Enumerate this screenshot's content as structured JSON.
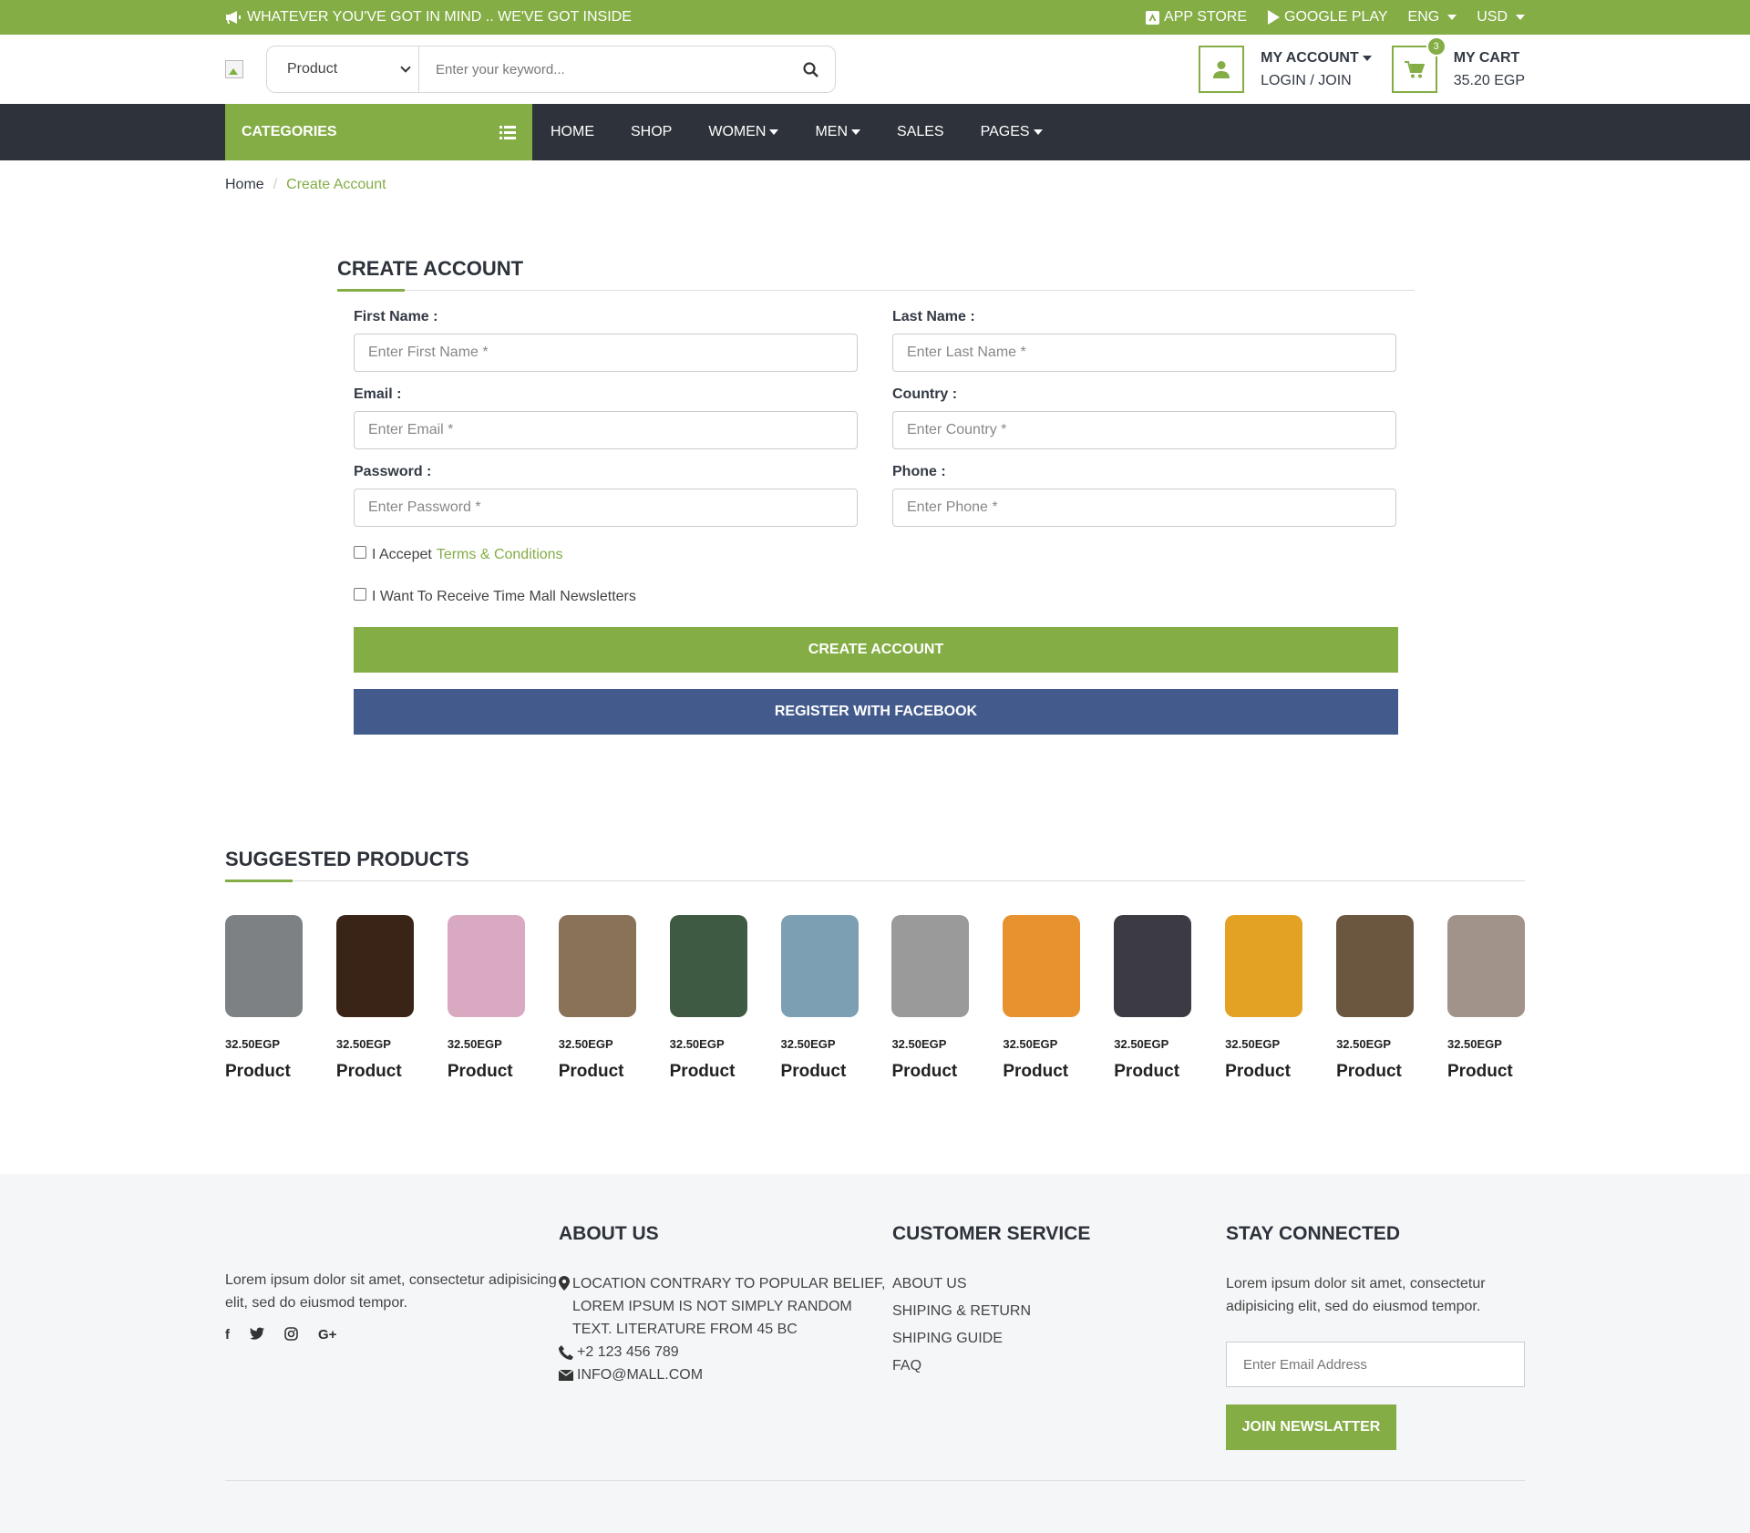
{
  "topbar": {
    "promo": "WHATEVER YOU'VE GOT IN MIND .. WE'VE GOT INSIDE",
    "app_store": "APP STORE",
    "google_play": "GOOGLE PLAY",
    "lang": "ENG",
    "currency": "USD"
  },
  "header": {
    "search_category": "Product",
    "search_placeholder": "Enter your keyword...",
    "account_title": "MY ACCOUNT",
    "account_sub": "LOGIN / JOIN",
    "cart_title": "MY CART",
    "cart_total": "35.20 EGP",
    "cart_count": "3"
  },
  "nav": {
    "categories": "CATEGORIES",
    "items": [
      {
        "label": "HOME",
        "dropdown": false
      },
      {
        "label": "SHOP",
        "dropdown": false
      },
      {
        "label": "WOMEN",
        "dropdown": true
      },
      {
        "label": "MEN",
        "dropdown": true
      },
      {
        "label": "SALES",
        "dropdown": false
      },
      {
        "label": "PAGES",
        "dropdown": true
      }
    ]
  },
  "breadcrumb": {
    "home": "Home",
    "current": "Create Account"
  },
  "form": {
    "title": "CREATE ACCOUNT",
    "first_name_label": "First Name :",
    "first_name_placeholder": "Enter First Name *",
    "last_name_label": "Last Name :",
    "last_name_placeholder": "Enter Last Name *",
    "email_label": "Email :",
    "email_placeholder": "Enter Email *",
    "country_label": "Country :",
    "country_placeholder": "Enter Country *",
    "password_label": "Password :",
    "password_placeholder": "Enter Password *",
    "phone_label": "Phone :",
    "phone_placeholder": "Enter Phone *",
    "accept_text": "I Accepet",
    "terms_link": "Terms & Conditions",
    "newsletter_text": "I Want To Receive Time Mall Newsletters",
    "create_button": "CREATE ACCOUNT",
    "facebook_button": "REGISTER WITH FACEBOOK"
  },
  "suggested": {
    "title": "SUGGESTED PRODUCTS",
    "products": [
      {
        "price": "32.50EGP",
        "name": "Product",
        "color": "#7d8184"
      },
      {
        "price": "32.50EGP",
        "name": "Product",
        "color": "#3a2418"
      },
      {
        "price": "32.50EGP",
        "name": "Product",
        "color": "#d8a9c0"
      },
      {
        "price": "32.50EGP",
        "name": "Product",
        "color": "#8a7258"
      },
      {
        "price": "32.50EGP",
        "name": "Product",
        "color": "#3f5a42"
      },
      {
        "price": "32.50EGP",
        "name": "Product",
        "color": "#7d9fb3"
      },
      {
        "price": "32.50EGP",
        "name": "Product",
        "color": "#9a9a9a"
      },
      {
        "price": "32.50EGP",
        "name": "Product",
        "color": "#e8922f"
      },
      {
        "price": "32.50EGP",
        "name": "Product",
        "color": "#3c3b44"
      },
      {
        "price": "32.50EGP",
        "name": "Product",
        "color": "#e4a224"
      },
      {
        "price": "32.50EGP",
        "name": "Product",
        "color": "#6b5740"
      },
      {
        "price": "32.50EGP",
        "name": "Product",
        "color": "#a2938a"
      }
    ]
  },
  "footer": {
    "about_text": "Lorem ipsum dolor sit amet, consectetur adipisicing elit, sed do eiusmod tempor.",
    "about_title": "ABOUT US",
    "location": "LOCATION CONTRARY TO POPULAR BELIEF, LOREM IPSUM IS NOT SIMPLY RANDOM TEXT. LITERATURE FROM 45 BC",
    "phone": "+2 123 456 789",
    "email": "INFO@MALL.COM",
    "service_title": "CUSTOMER SERVICE",
    "service_links": [
      "ABOUT US",
      "SHIPING & RETURN",
      "SHIPING GUIDE",
      "FAQ"
    ],
    "connected_title": "STAY CONNECTED",
    "connected_text": "Lorem ipsum dolor sit amet, consectetur adipisicing elit, sed do eiusmod tempor.",
    "email_placeholder": "Enter Email Address",
    "join_button": "JOIN NEWSLATTER"
  },
  "colors": {
    "accent": "#84ad45",
    "dark": "#2d323b",
    "facebook": "#435a8c"
  }
}
